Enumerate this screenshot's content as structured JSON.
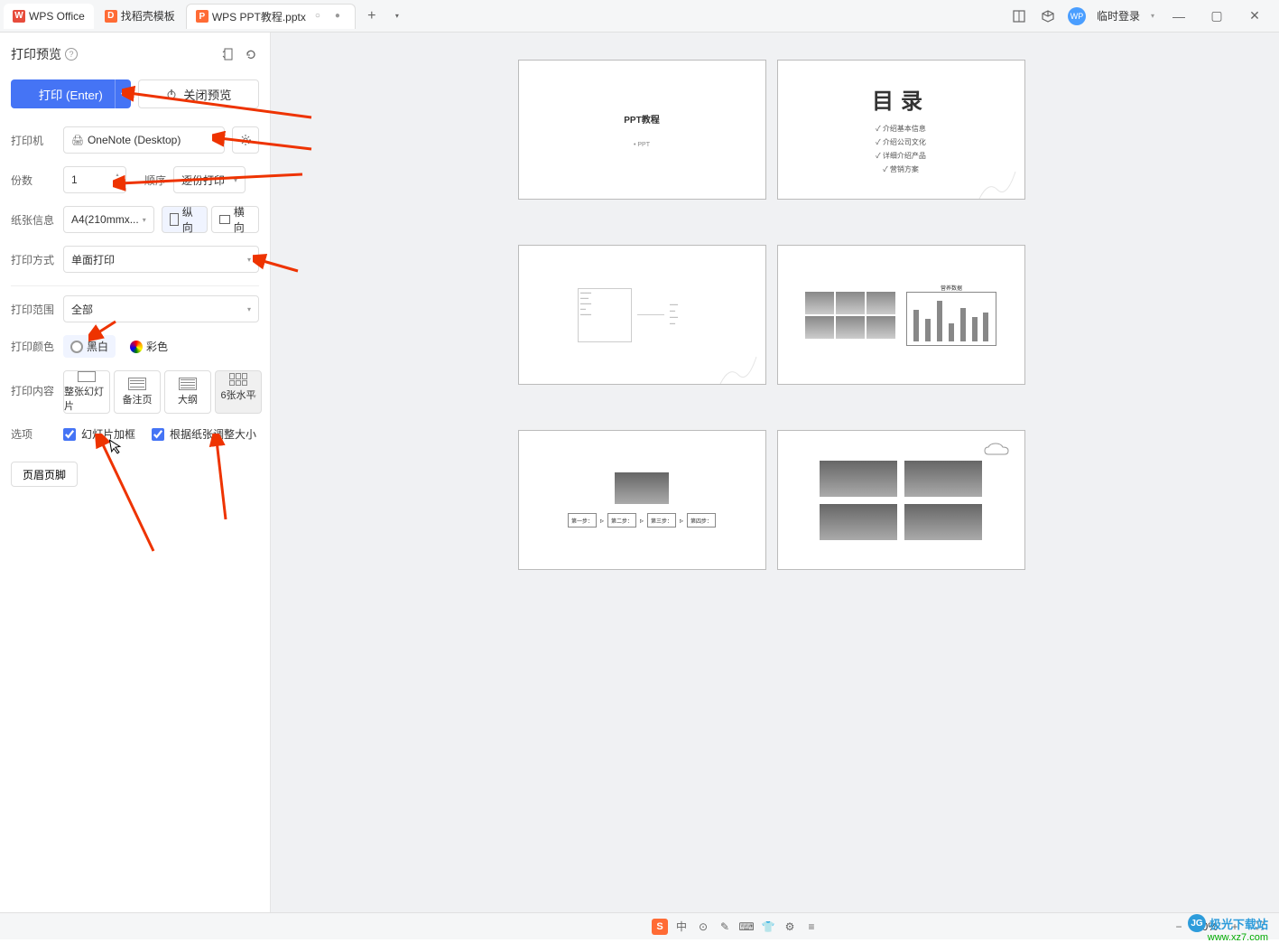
{
  "titlebar": {
    "wps_label": "WPS Office",
    "template_label": "找稻壳模板",
    "file_label": "WPS PPT教程.pptx",
    "login_label": "临时登录",
    "avatar_text": "WP"
  },
  "sidebar": {
    "title": "打印预览",
    "print_btn": "打印 (Enter)",
    "close_btn": "关闭预览",
    "printer_label": "打印机",
    "printer_value": "OneNote (Desktop)",
    "copies_label": "份数",
    "copies_value": "1",
    "order_label": "顺序",
    "order_value": "逐份打印",
    "paper_label": "纸张信息",
    "paper_value": "A4(210mmx...",
    "portrait": "纵向",
    "landscape": "横向",
    "mode_label": "打印方式",
    "mode_value": "单面打印",
    "range_label": "打印范围",
    "range_value": "全部",
    "color_label": "打印颜色",
    "bw": "黑白",
    "color": "彩色",
    "content_label": "打印内容",
    "content_opts": [
      "整张幻灯片",
      "备注页",
      "大纲",
      "6张水平"
    ],
    "options_label": "选项",
    "check1": "幻灯片加框",
    "check2": "根据纸张调整大小",
    "footer_btn": "页眉页脚"
  },
  "slides": {
    "s1_title": "PPT教程",
    "s1_sub": "• PPT",
    "s2_title": "目录",
    "s2_items": [
      "✓ 介绍基本信息",
      "✓ 介绍公司文化",
      "✓ 详细介绍产品",
      "✓ 营销方案"
    ],
    "s4_chart_title": "营养数据",
    "s5_steps": [
      "第一步：",
      "第二步：",
      "第三步：",
      "第四步："
    ]
  },
  "statusbar": {
    "ime": "中",
    "zoom": "80%"
  },
  "watermark": {
    "name": "极光下载站",
    "url": "www.xz7.com"
  }
}
